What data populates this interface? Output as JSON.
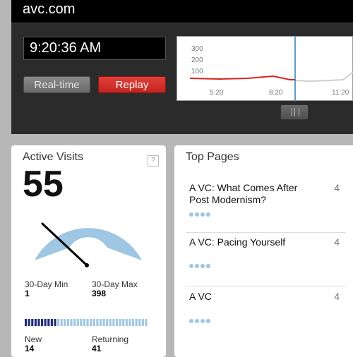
{
  "header": {
    "domain": "avc.com",
    "time": "9:20:36 AM",
    "realtime_label": "Real-time",
    "replay_label": "Replay"
  },
  "chart_data": {
    "type": "line",
    "y_ticks": [
      "300",
      "200",
      "100"
    ],
    "x_ticks": [
      "5:20",
      "8:20",
      "11:20"
    ],
    "series": [
      {
        "values": [
          {
            "x": "5:20",
            "y": 95
          },
          {
            "x": "6:20",
            "y": 96
          },
          {
            "x": "7:20",
            "y": 95
          },
          {
            "x": "8:00",
            "y": 99
          },
          {
            "x": "8:20",
            "y": 96
          },
          {
            "x": "9:20",
            "y": 96
          }
        ]
      },
      {
        "values": [
          {
            "x": "9:20",
            "y": 96
          },
          {
            "x": "10:20",
            "y": 90
          },
          {
            "x": "11:20",
            "y": 92
          },
          {
            "x": "12:00",
            "y": 110
          }
        ]
      }
    ]
  },
  "visits": {
    "title": "Active Visits",
    "help": "?",
    "count": "55",
    "min_label": "30-Day Min",
    "min_value": "1",
    "max_label": "30-Day Max",
    "max_value": "398",
    "new_label": "New",
    "new_value": "14",
    "returning_label": "Returning",
    "returning_value": "41",
    "gauge_fraction": 0.14,
    "new_fraction": 0.25
  },
  "top_pages": {
    "title": "Top Pages",
    "items": [
      {
        "title": "A VC: What Comes After Post Modernism?",
        "count": "4"
      },
      {
        "title": "A VC: Pacing Yourself",
        "count": "4"
      },
      {
        "title": "A VC",
        "count": "4"
      }
    ]
  },
  "colors": {
    "accent_red": "#cf2b27",
    "gauge_blue": "#9fc6e2",
    "bar_navy": "#1e2b7a"
  }
}
